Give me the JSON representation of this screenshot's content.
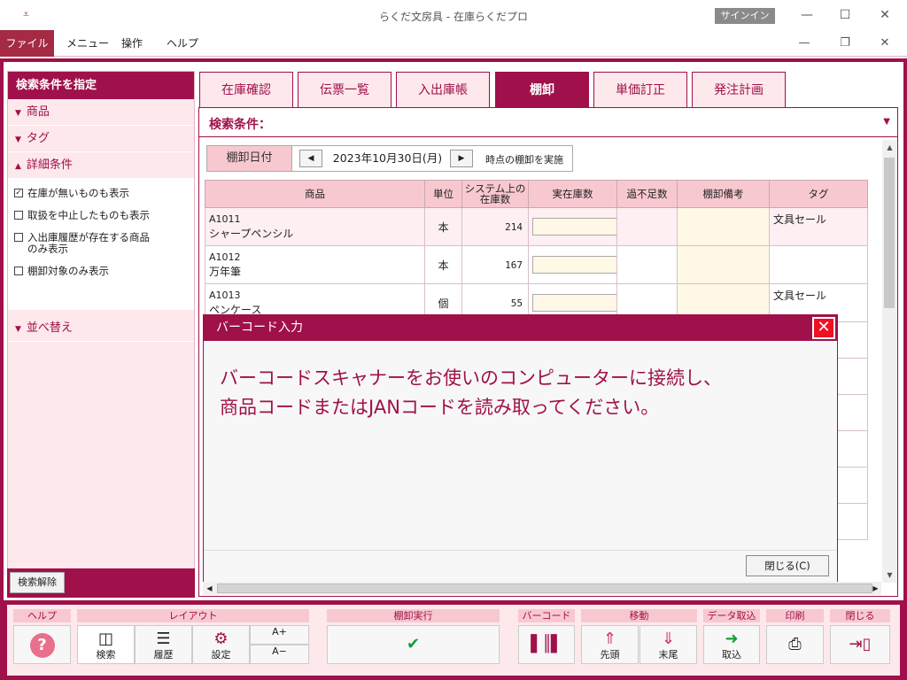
{
  "window": {
    "title": "らくだ文房具 - 在庫らくだプロ",
    "signin_label": "サインイン",
    "controls": {
      "minimize": "—",
      "maximize": "☐",
      "close": "✕"
    }
  },
  "menu": {
    "items": [
      "ファイル",
      "メニュー",
      "操作",
      "ヘルプ"
    ],
    "mdi": {
      "minimize": "—",
      "restore": "❐",
      "close": "✕"
    }
  },
  "left_panel": {
    "header": "検索条件を指定",
    "sections": [
      {
        "label": "商品",
        "expanded": false
      },
      {
        "label": "タグ",
        "expanded": false
      },
      {
        "label": "詳細条件",
        "expanded": true
      }
    ],
    "checkboxes": [
      {
        "label": "在庫が無いものも表示",
        "checked": true
      },
      {
        "label": "取扱を中止したものも表示",
        "checked": false
      },
      {
        "label": "入出庫履歴が存在する商品のみ表示",
        "checked": false
      },
      {
        "label": "棚卸対象のみ表示",
        "checked": false
      }
    ],
    "sort_section": "並べ替え",
    "clear_button": "検索解除"
  },
  "tabs": [
    {
      "label": "在庫確認",
      "active": false
    },
    {
      "label": "伝票一覧",
      "active": false
    },
    {
      "label": "入出庫帳",
      "active": false
    },
    {
      "label": "棚卸",
      "active": true
    },
    {
      "label": "単価訂正",
      "active": false
    },
    {
      "label": "発注計画",
      "active": false
    }
  ],
  "search": {
    "label": "検索条件：",
    "date_label": "棚卸日付",
    "date_value": "2023年10月30日(月)",
    "date_suffix": "時点の棚卸を実施"
  },
  "table": {
    "columns": [
      "商品",
      "単位",
      "システム上の在庫数",
      "実在庫数",
      "過不足数",
      "棚卸備考",
      "タグ"
    ],
    "rows": [
      {
        "code": "A1011",
        "name": "シャープペンシル",
        "unit": "本",
        "system_qty": "214",
        "tag": "文具セール"
      },
      {
        "code": "A1012",
        "name": "万年筆",
        "unit": "本",
        "system_qty": "167",
        "tag": ""
      },
      {
        "code": "A1013",
        "name": "ペンケース",
        "unit": "個",
        "system_qty": "55",
        "tag": "文具セール"
      }
    ]
  },
  "modal": {
    "title": "バーコード入力",
    "message_line1": "バーコードスキャナーをお使いのコンピューターに接続し、",
    "message_line2": "商品コードまたはJANコードを読み取ってください。",
    "close_button": "閉じる(C)"
  },
  "toolbar": {
    "groups": {
      "help": "ヘルプ",
      "layout": "レイアウト",
      "stocktake": "棚卸実行",
      "barcode": "バーコード",
      "move": "移動",
      "import": "データ取込",
      "print": "印刷",
      "close": "閉じる"
    },
    "buttons": {
      "search": "検索",
      "history": "履歴",
      "settings": "設定",
      "first": "先頭",
      "last": "末尾",
      "import": "取込"
    },
    "font_up": "A+",
    "font_down": "A−"
  }
}
